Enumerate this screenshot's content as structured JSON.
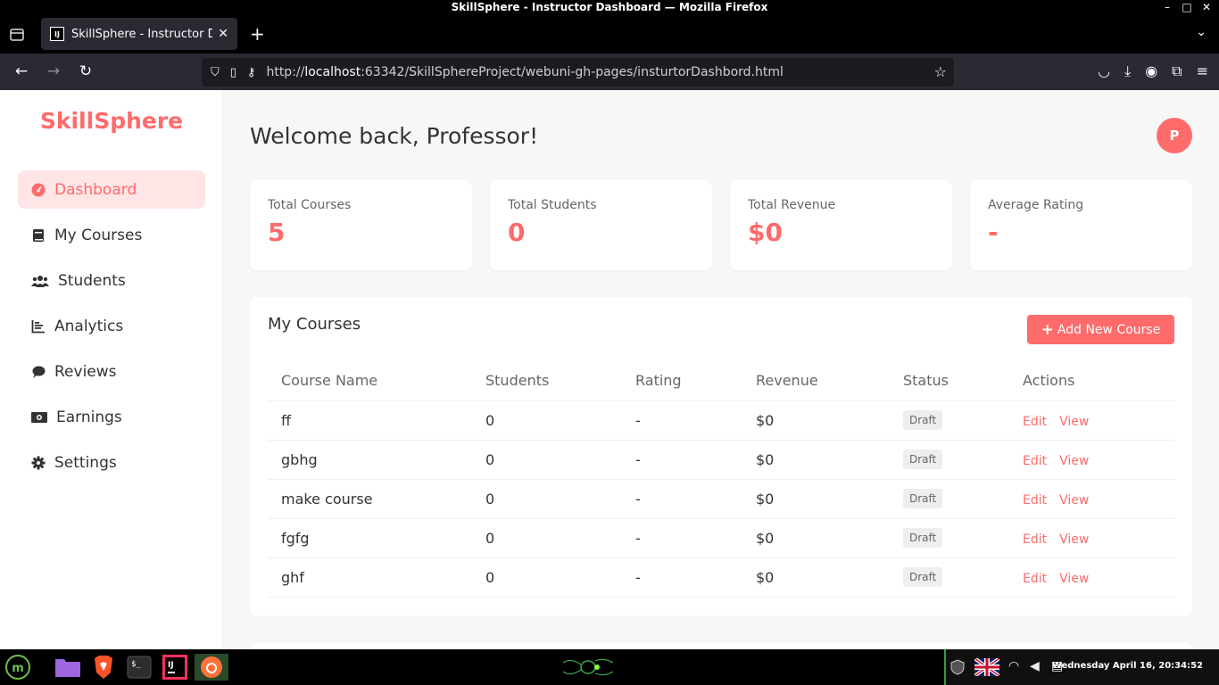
{
  "window": {
    "title": "SkillSphere - Instructor Dashboard — Mozilla Firefox",
    "controls": [
      "–",
      "□",
      "✕"
    ]
  },
  "browser": {
    "tab_title": "SkillSphere - Instructor Dashboard",
    "tab_favicon": "IJ",
    "url_prefix": "http://",
    "url_host": "localhost",
    "url_rest": ":63342/SkillSphereProject/webuni-gh-pages/insturtorDashbord.html"
  },
  "sidebar": {
    "brand": "SkillSphere",
    "items": [
      {
        "label": "Dashboard",
        "icon": "gauge-icon",
        "active": true
      },
      {
        "label": "My Courses",
        "icon": "book-icon",
        "active": false
      },
      {
        "label": "Students",
        "icon": "users-icon",
        "active": false
      },
      {
        "label": "Analytics",
        "icon": "chart-icon",
        "active": false
      },
      {
        "label": "Reviews",
        "icon": "comment-icon",
        "active": false
      },
      {
        "label": "Earnings",
        "icon": "money-icon",
        "active": false
      },
      {
        "label": "Settings",
        "icon": "gear-icon",
        "active": false
      }
    ]
  },
  "header": {
    "welcome": "Welcome back, Professor!",
    "avatar_initial": "P"
  },
  "stats": [
    {
      "label": "Total Courses",
      "value": "5"
    },
    {
      "label": "Total Students",
      "value": "0"
    },
    {
      "label": "Total Revenue",
      "value": "$0"
    },
    {
      "label": "Average Rating",
      "value": "-"
    }
  ],
  "courses": {
    "title": "My Courses",
    "add_button": "Add New Course",
    "columns": [
      "Course Name",
      "Students",
      "Rating",
      "Revenue",
      "Status",
      "Actions"
    ],
    "rows": [
      {
        "name": "ff",
        "students": "0",
        "rating": "-",
        "revenue": "$0",
        "status": "Draft",
        "edit": "Edit",
        "view": "View"
      },
      {
        "name": "gbhg",
        "students": "0",
        "rating": "-",
        "revenue": "$0",
        "status": "Draft",
        "edit": "Edit",
        "view": "View"
      },
      {
        "name": "make course",
        "students": "0",
        "rating": "-",
        "revenue": "$0",
        "status": "Draft",
        "edit": "Edit",
        "view": "View"
      },
      {
        "name": "fgfg",
        "students": "0",
        "rating": "-",
        "revenue": "$0",
        "status": "Draft",
        "edit": "Edit",
        "view": "View"
      },
      {
        "name": "ghf",
        "students": "0",
        "rating": "-",
        "revenue": "$0",
        "status": "Draft",
        "edit": "Edit",
        "view": "View"
      }
    ]
  },
  "taskbar": {
    "clock": "Wednesday April 16, 20:34:52"
  },
  "colors": {
    "accent": "#ff6b6b",
    "accent_light": "#ffe5e5"
  }
}
